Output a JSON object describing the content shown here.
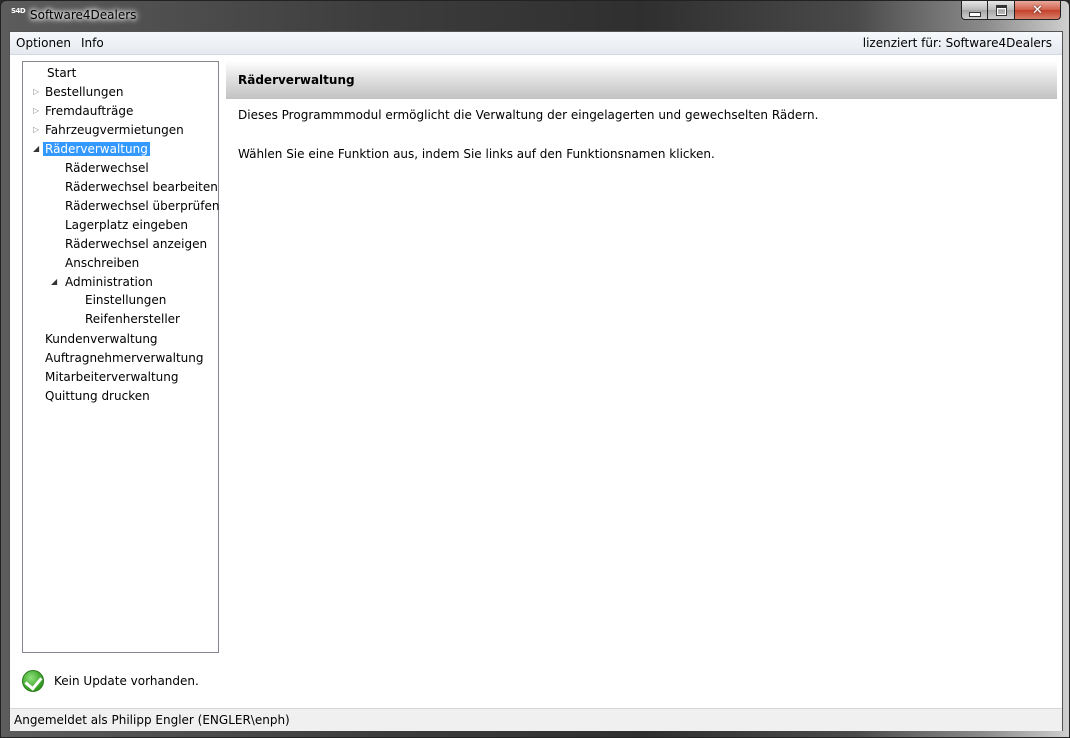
{
  "window": {
    "icon_text": "S4D",
    "title": "Software4Dealers",
    "min_label": "",
    "close_label": "✕"
  },
  "menu": {
    "items": [
      {
        "label": "Optionen"
      },
      {
        "label": "Info"
      }
    ],
    "license_text": "lizenziert für: Software4Dealers"
  },
  "tree": {
    "nodes": [
      {
        "label": "Start"
      },
      {
        "label": "Bestellungen"
      },
      {
        "label": "Fremdaufträge"
      },
      {
        "label": "Fahrzeugvermietungen"
      },
      {
        "label": "Räderverwaltung"
      },
      {
        "label": "Räderwechsel"
      },
      {
        "label": "Räderwechsel bearbeiten"
      },
      {
        "label": "Räderwechsel überprüfen"
      },
      {
        "label": "Lagerplatz eingeben"
      },
      {
        "label": "Räderwechsel anzeigen"
      },
      {
        "label": "Anschreiben"
      },
      {
        "label": "Administration"
      },
      {
        "label": "Einstellungen"
      },
      {
        "label": "Reifenhersteller"
      },
      {
        "label": "Kundenverwaltung"
      },
      {
        "label": "Auftragnehmerverwaltung"
      },
      {
        "label": "Mitarbeiterverwaltung"
      },
      {
        "label": "Quittung drucken"
      }
    ],
    "selected": "Räderverwaltung",
    "arrow_collapsed": "▷",
    "arrow_expanded": "◢"
  },
  "content": {
    "title": "Räderverwaltung",
    "paragraph1": "Dieses Programmmodul ermöglicht die Verwaltung der eingelagerten und gewechselten Rädern.",
    "paragraph2": "Wählen Sie eine Funktion aus, indem Sie links auf den Funktionsnamen klicken."
  },
  "update": {
    "text": "Kein Update vorhanden."
  },
  "status": {
    "text": "Angemeldet als Philipp Engler (ENGLER\\enph)"
  },
  "colors": {
    "selection": "#3399ff",
    "close_button": "#c4402a"
  }
}
